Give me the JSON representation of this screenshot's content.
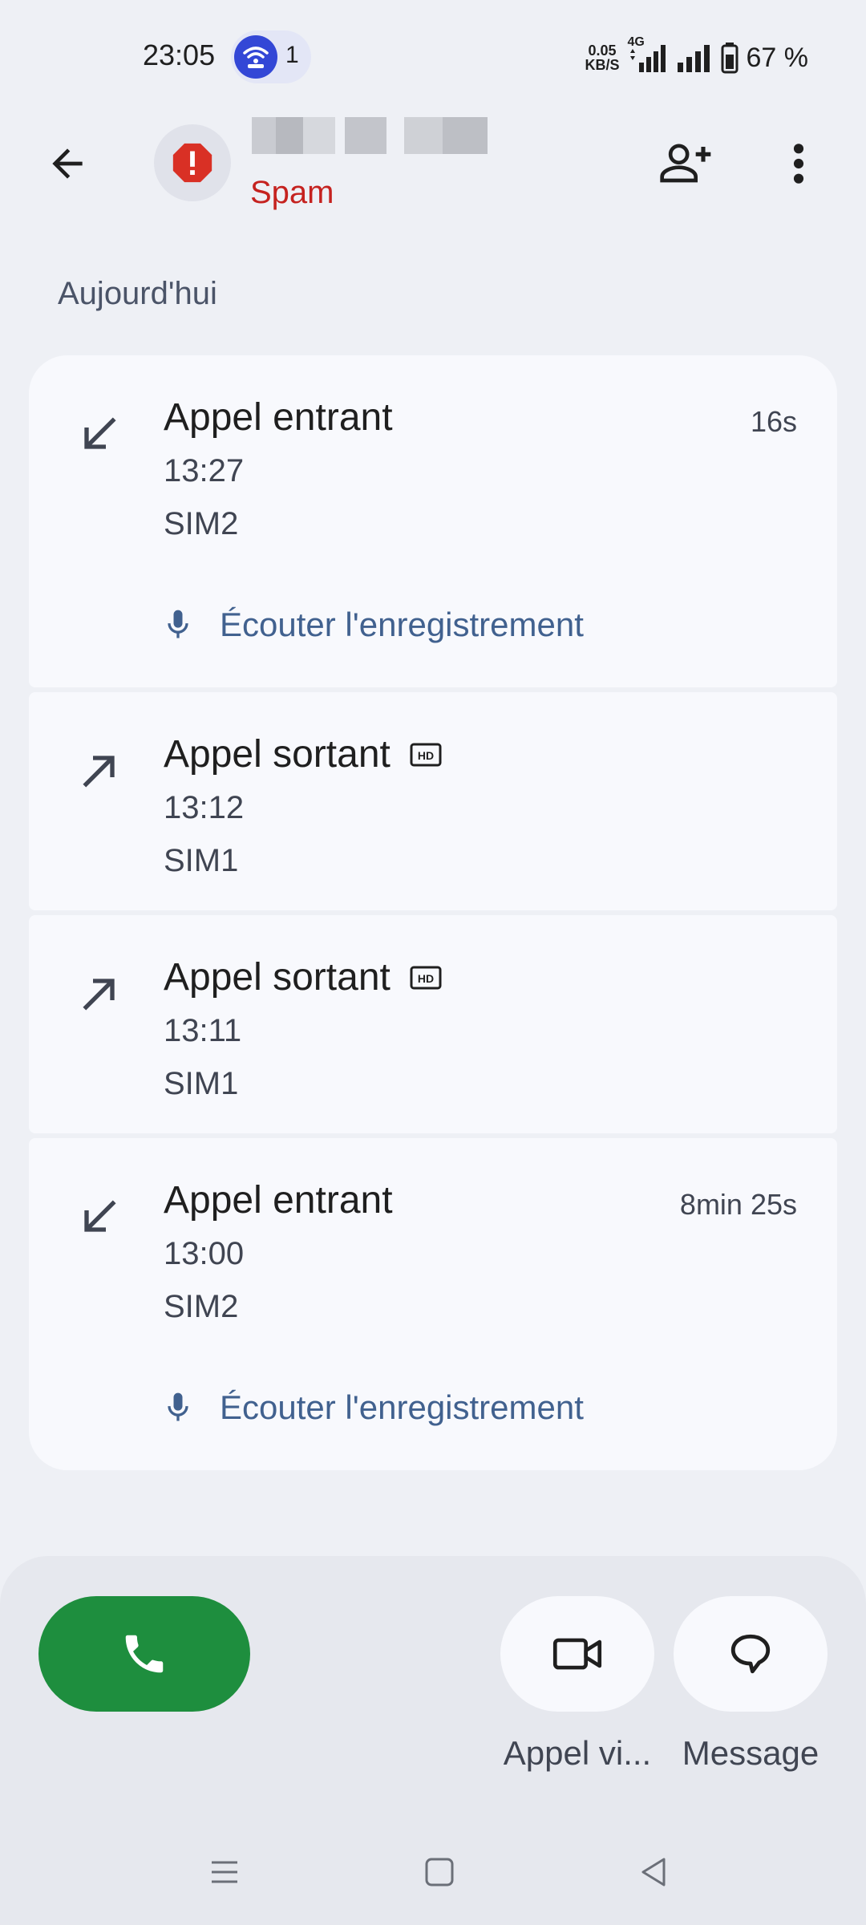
{
  "status_bar": {
    "time": "23:05",
    "hotspot_count": "1",
    "speed_value": "0.05",
    "speed_unit": "KB/S",
    "network_type": "4G",
    "battery": "67 %"
  },
  "header": {
    "contact_label": "Spam"
  },
  "section": {
    "title": "Aujourd'hui"
  },
  "calls": [
    {
      "type": "Appel entrant",
      "time": "13:27",
      "sim": "SIM2",
      "duration": "16s",
      "recording": "Écouter l'enregistrement"
    },
    {
      "type": "Appel sortant",
      "time": "13:12",
      "sim": "SIM1",
      "hd": "HD"
    },
    {
      "type": "Appel sortant",
      "time": "13:11",
      "sim": "SIM1",
      "hd": "HD"
    },
    {
      "type": "Appel entrant",
      "time": "13:00",
      "sim": "SIM2",
      "duration": "8min 25s",
      "recording": "Écouter l'enregistrement"
    }
  ],
  "actions": {
    "video_label": "Appel vi...",
    "message_label": "Message"
  },
  "colors": {
    "spam": "#c5221f",
    "call_green": "#1e8e3e",
    "link_blue": "#41618f"
  }
}
